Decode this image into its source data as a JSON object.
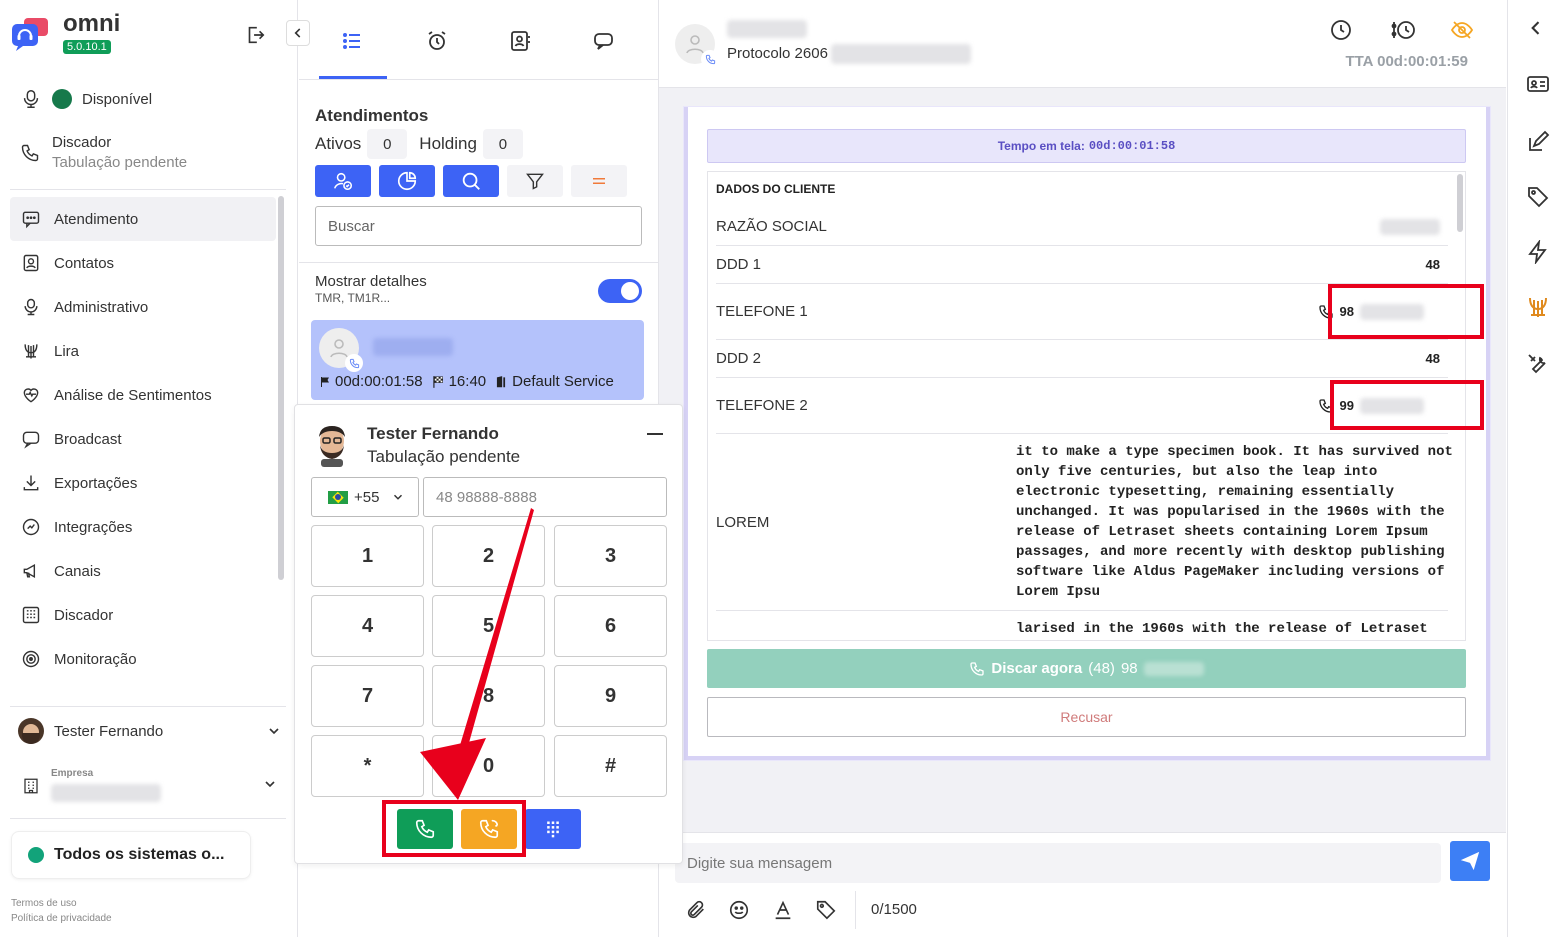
{
  "brand": {
    "name": "omni",
    "version": "5.0.10.1"
  },
  "sidebar": {
    "status": "Disponível",
    "dialer": {
      "title": "Discador",
      "subtitle": "Tabulação pendente"
    },
    "nav": [
      {
        "label": "Atendimento",
        "icon": "chat-icon",
        "active": true
      },
      {
        "label": "Contatos",
        "icon": "contacts-icon"
      },
      {
        "label": "Administrativo",
        "icon": "admin-icon"
      },
      {
        "label": "Lira",
        "icon": "lira-icon"
      },
      {
        "label": "Análise de Sentimentos",
        "icon": "heart-icon"
      },
      {
        "label": "Broadcast",
        "icon": "broadcast-icon"
      },
      {
        "label": "Exportações",
        "icon": "download-icon"
      },
      {
        "label": "Integrações",
        "icon": "integrations-icon"
      },
      {
        "label": "Canais",
        "icon": "megaphone-icon"
      },
      {
        "label": "Discador",
        "icon": "dialer-icon"
      },
      {
        "label": "Monitoração",
        "icon": "monitor-icon"
      }
    ],
    "user": "Tester Fernando",
    "company_label": "Empresa",
    "systems_status": "Todos os sistemas o...",
    "legal": {
      "terms": "Termos de uso",
      "privacy": "Política de privacidade"
    }
  },
  "middle": {
    "title": "Atendimentos",
    "ativos_label": "Ativos",
    "ativos_count": "0",
    "holding_label": "Holding",
    "holding_count": "0",
    "search_placeholder": "Buscar",
    "details_label": "Mostrar detalhes",
    "details_sub": "TMR, TM1R...",
    "card": {
      "time": "00d:00:01:58",
      "clock": "16:40",
      "service": "Default Service"
    }
  },
  "dialer_popup": {
    "name": "Tester Fernando",
    "status": "Tabulação pendente",
    "country_code": "+55",
    "phone_placeholder": "48 98888-8888",
    "keys": [
      "1",
      "2",
      "3",
      "4",
      "5",
      "6",
      "7",
      "8",
      "9",
      "*",
      "0",
      "#"
    ]
  },
  "main": {
    "protocol": "Protocolo 2606",
    "tta": "TTA 00d:00:01:59",
    "tela_label": "Tempo em tela:",
    "tela_time": "00d:00:01:58",
    "section": "DADOS DO CLIENTE",
    "fields": {
      "razao": "RAZÃO SOCIAL",
      "ddd1": "DDD 1",
      "ddd1_val": "48",
      "tel1": "TELEFONE 1",
      "tel1_val": "98",
      "ddd2": "DDD 2",
      "ddd2_val": "48",
      "tel2": "TELEFONE 2",
      "tel2_val": "99",
      "lorem": "LOREM",
      "lorem_text": "it to make a type specimen book. It has survived not only five centuries, but also the leap into electronic typesetting, remaining essentially unchanged. It was popularised in the 1960s with the release of Letraset sheets containing Lorem Ipsum passages, and more recently with desktop publishing software like Aldus PageMaker including versions of Lorem Ipsu",
      "lorem_text2": "larised in the 1960s with the release of Letraset"
    },
    "discar_label": "Discar agora",
    "discar_ddd": "(48)",
    "discar_num": "98",
    "recusar": "Recusar",
    "message_placeholder": "Digite sua mensagem",
    "char_count": "0/1500"
  },
  "colors": {
    "primary": "#3d63f5",
    "green": "#0f9d58",
    "orange": "#f5a623",
    "highlight": "#e8001c"
  }
}
